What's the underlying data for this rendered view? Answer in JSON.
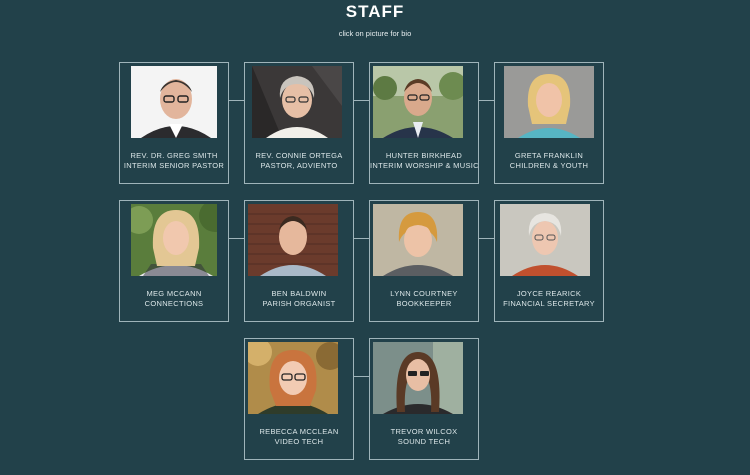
{
  "page": {
    "title": "STAFF",
    "subtitle": "click on picture for bio"
  },
  "staff": [
    {
      "name": "REV. DR. GREG SMITH",
      "role": "INTERIM SENIOR PASTOR"
    },
    {
      "name": "REV. CONNIE ORTEGA",
      "role": "PASTOR, ADVIENTO"
    },
    {
      "name": "HUNTER BIRKHEAD",
      "role": "INTERIM WORSHIP & MUSIC"
    },
    {
      "name": "GRETA FRANKLIN",
      "role": "CHILDREN & YOUTH"
    },
    {
      "name": "MEG MCCANN",
      "role": "CONNECTIONS"
    },
    {
      "name": "BEN BALDWIN",
      "role": "PARISH ORGANIST"
    },
    {
      "name": "LYNN COURTNEY",
      "role": "BOOKKEEPER"
    },
    {
      "name": "JOYCE REARICK",
      "role": "FINANCIAL SECRETARY"
    },
    {
      "name": "REBECCA MCCLEAN",
      "role": "VIDEO TECH"
    },
    {
      "name": "TREVOR WILCOX",
      "role": "SOUND TECH"
    }
  ],
  "colors": {
    "background": "#22414a",
    "card_border": "#9fb4ba",
    "text": "#dbe6e8"
  }
}
